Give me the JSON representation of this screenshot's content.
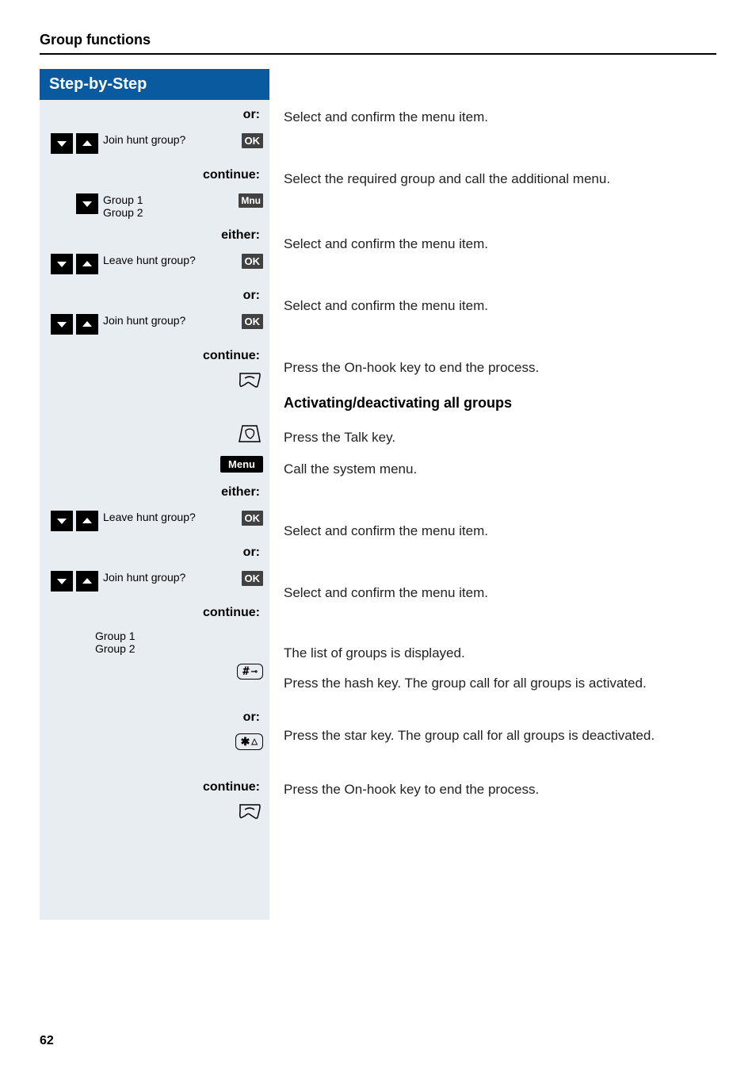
{
  "header": {
    "title": "Group functions"
  },
  "leftCol": {
    "title": "Step-by-Step"
  },
  "connectors": {
    "or": "or:",
    "continue": "continue:",
    "either": "either:"
  },
  "buttons": {
    "ok": "OK",
    "mnu": "Mnu",
    "menu": "Menu"
  },
  "displays": {
    "joinHunt": "Join hunt group?",
    "leaveHunt": "Leave hunt group?",
    "group1": "Group 1",
    "group2": "Group 2"
  },
  "explanations": {
    "selectConfirm": "Select and confirm the menu item.",
    "selectRequiredGroup": "Select the required group and call the additional menu.",
    "pressOnHook": "Press the On-hook key to end the process.",
    "activatingHeading": "Activating/deactivating all groups",
    "pressTalk": "Press the Talk key.",
    "callSystemMenu": "Call the system menu.",
    "listGroupsDisplayed": "The list of groups is displayed.",
    "pressHash": "Press the hash key. The group call for all groups is activated.",
    "pressStar": "Press the star key. The group call for all groups is deactivated."
  },
  "pageNumber": "62"
}
